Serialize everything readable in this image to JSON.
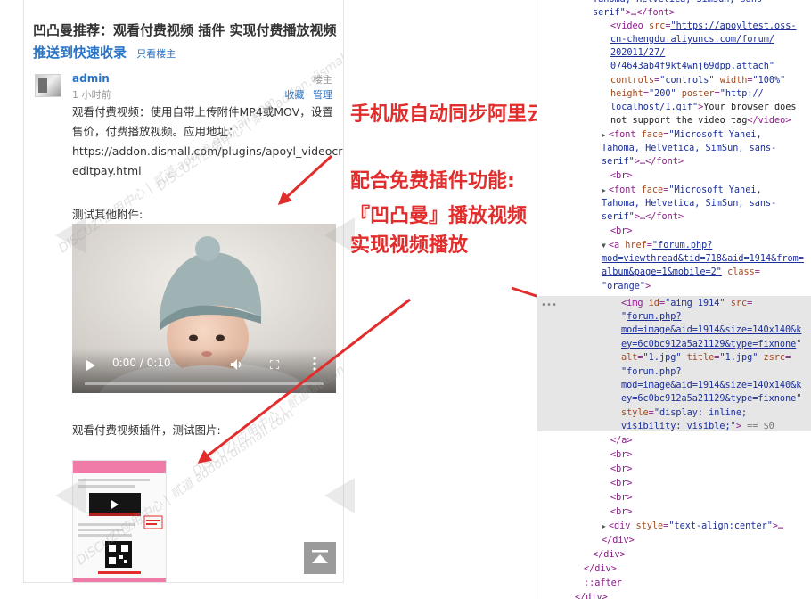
{
  "mobile": {
    "title": "凹凸曼推荐：观看付费视频 插件 实现付费播放视频",
    "quick_link": "推送到快速收录",
    "only_op": "只看楼主",
    "author": "admin",
    "post_time": "1 小时前",
    "floor": "楼主",
    "actions": [
      "收藏",
      "管理"
    ],
    "body_lines": [
      "观看付费视频：使用自带上传附件MP4或MOV，设置",
      "售价，付费播放视频。应用地址：",
      "https://addon.dismall.com/plugins/apoyl_videocr",
      "editpay.html"
    ],
    "test_other": "测试其他附件:",
    "video_time": "0:00 / 0:10",
    "image_caption": "观看付费视频插件，测试图片:",
    "watermark": "DISCUZ!应用中心 | 贰道 addon.dismall.com"
  },
  "annotations": [
    "手机版自动同步阿里云",
    "配合免费插件功能:",
    "『凹凸曼』播放视频",
    "实现视频播放"
  ],
  "colors": {
    "accent": "#e22d2d",
    "link": "#2a74c8",
    "selection": "#e6e6e6"
  }
}
